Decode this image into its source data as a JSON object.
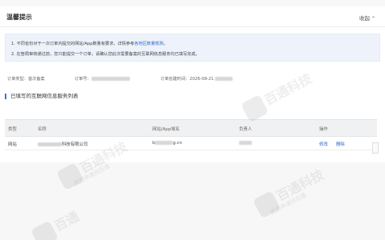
{
  "card": {
    "title": "温馨提示",
    "collapse_label": "收起"
  },
  "tips": {
    "line1_prefix": "1. 不同省份对于一次订单内提交的网站/App数量有要求，详情参考",
    "line1_link": "各地区数量规则",
    "line1_suffix": "。",
    "line2": "2. 在管局审核通过前，您只能提交一个订单，请确认您此次需要备案的互联网信息服务均已填写完成。"
  },
  "order": {
    "type_label": "订单类型：",
    "type_value": "首次备案",
    "id_label": "订单号：",
    "time_label": "订单创建时间：",
    "time_value": "2026-08-21"
  },
  "section": {
    "title": "已填写的互联网信息服务列表"
  },
  "table": {
    "headers": [
      "类型",
      "名称",
      "网站/App域名",
      "负责人",
      "操作"
    ],
    "rows": [
      {
        "type": "网站",
        "name_suffix": "科技有限公司",
        "domain_prefix": "b",
        "domain_suffix": "g.cn",
        "actions": [
          "修改",
          "删除"
        ]
      }
    ]
  },
  "watermark": {
    "brand": "百通科技",
    "sub": "资质申请找百通",
    "brand_short": "百通"
  }
}
